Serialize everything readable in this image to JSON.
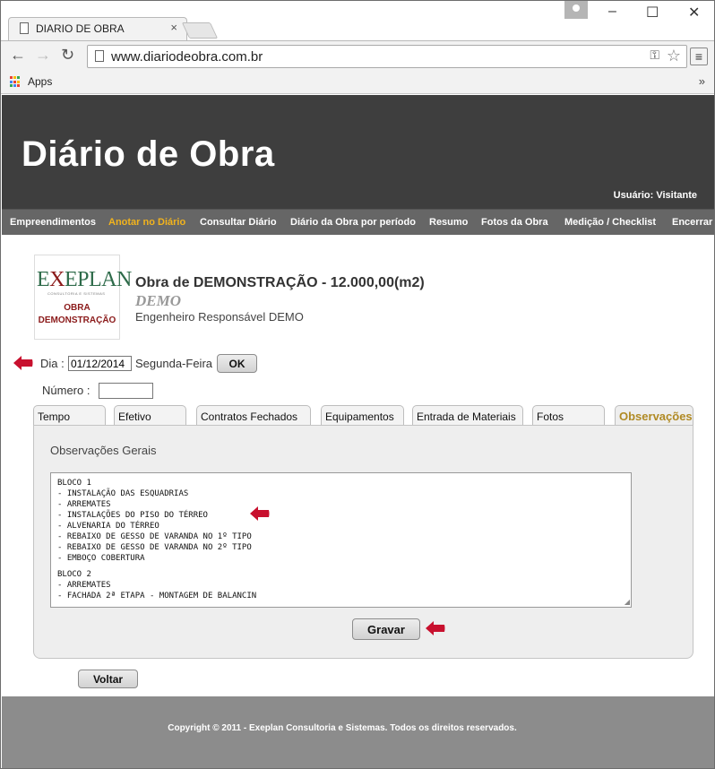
{
  "browser": {
    "tab_title": "DIARIO DE OBRA",
    "tab_close": "×",
    "url": "www.diariodeobra.com.br",
    "bookmarks_apps": "Apps",
    "bookmarks_more": "»",
    "window_controls": {
      "minimize": "–",
      "maximize": "☐",
      "close": "✕"
    },
    "nav": {
      "back": "←",
      "forward": "→",
      "reload": "↻"
    },
    "menu": "≡"
  },
  "site": {
    "title": "Diário de Obra",
    "user_label": "Usuário: Visitante"
  },
  "navbar": {
    "items": [
      {
        "label": "Empreendimentos"
      },
      {
        "label": "Anotar no Diário"
      },
      {
        "label": "Consultar Diário"
      },
      {
        "label": "Diário da Obra por período"
      },
      {
        "label": "Resumo"
      },
      {
        "label": "Fotos da Obra"
      },
      {
        "label": "Medição / Checklist"
      },
      {
        "label": "Encerrar"
      }
    ],
    "active_index": 1
  },
  "project": {
    "logo_brand_e": "E",
    "logo_brand_x": "X",
    "logo_brand_rest": "EPLAN",
    "logo_tagline": "CONSULTORIA E SISTEMAS",
    "logo_sub_line1": "OBRA",
    "logo_sub_line2": "DEMONSTRAÇÃO",
    "title": "Obra de DEMONSTRAÇÃO - 12.000,00(m2)",
    "code": "DEMO",
    "engineer": "Engenheiro Responsável DEMO"
  },
  "form": {
    "dia_label": "Dia :",
    "dia_value": "01/12/2014",
    "weekday": "Segunda-Feira",
    "ok_button": "OK",
    "numero_label": "Número :",
    "numero_value": ""
  },
  "tabs": [
    {
      "label": "Tempo"
    },
    {
      "label": "Efetivo"
    },
    {
      "label": "Contratos Fechados"
    },
    {
      "label": "Equipamentos"
    },
    {
      "label": "Entrada de Materiais"
    },
    {
      "label": "Fotos"
    },
    {
      "label": "Observações"
    }
  ],
  "panel": {
    "label": "Observações Gerais",
    "lines": [
      "BLOCO 1",
      "- INSTALAÇÃO DAS ESQUADRIAS",
      "- ARREMATES",
      "- INSTALAÇÕES DO PISO DO TÉRREO",
      "- ALVENARIA DO TÉRREO",
      "- REBAIXO DE GESSO DE VARANDA NO 1º TIPO",
      "- REBAIXO DE GESSO DE VARANDA NO 2º TIPO",
      "- EMBOÇO COBERTURA",
      "BLOCO 2",
      "- ARREMATES",
      "- FACHADA 2ª ETAPA - MONTAGEM DE BALANCIN"
    ],
    "save_button": "Gravar"
  },
  "back_button": "Voltar",
  "footer": {
    "copyright": "Copyright © 2011 - Exeplan Consultoria e Sistemas. Todos os direitos reservados."
  },
  "colors": {
    "header_bg": "#3e3e3e",
    "navbar_bg": "#666666",
    "nav_active": "#f2b31d",
    "arrow_red": "#c8102e",
    "footer_bg": "#8c8c8c",
    "logo_green": "#2e6b4a",
    "logo_red": "#8b1a1a"
  }
}
